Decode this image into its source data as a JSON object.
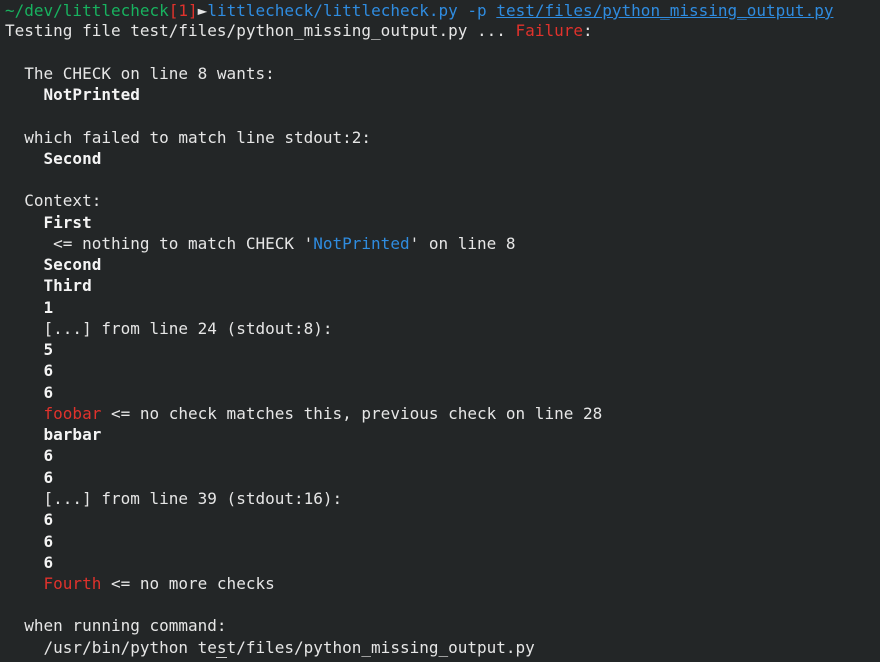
{
  "prompt": {
    "cwd": "~/dev/littlecheck",
    "status": "[1]",
    "arrow": "►",
    "cmd": "littlecheck/littlecheck.py",
    "flag": "-p",
    "file": "test/files/python_missing_output.py"
  },
  "header": {
    "prefix": "Testing file test/files/python_missing_output.py ... ",
    "result": "Failure",
    "suffix": ":"
  },
  "check_wants": {
    "label": "The CHECK on line 8 wants:",
    "value": "NotPrinted"
  },
  "failed_match": {
    "label": "which failed to match line stdout:2:",
    "value": "Second"
  },
  "context": {
    "label": "Context:",
    "first": "First",
    "nothing_prefix": " <= nothing to match CHECK '",
    "nothing_token": "NotPrinted",
    "nothing_suffix": "' on line 8",
    "second": "Second",
    "third": "Third",
    "one": "1",
    "skip1": "[...] from line 24 (stdout:8):",
    "v5": "5",
    "v6a": "6",
    "v6b": "6",
    "foobar": "foobar",
    "foobar_note": " <= no check matches this, previous check on line 28",
    "barbar": "barbar",
    "v6c": "6",
    "v6d": "6",
    "skip2": "[...] from line 39 (stdout:16):",
    "v6e": "6",
    "v6f": "6",
    "v6g": "6",
    "fourth": "Fourth",
    "fourth_note": " <= no more checks"
  },
  "running": {
    "label": "when running command:",
    "command": "/usr/bin/python test/files/python_missing_output.py"
  },
  "colors": {
    "background": "#232627",
    "green": "#18b25f",
    "red": "#e0322c",
    "blue": "#2f8ce0"
  }
}
